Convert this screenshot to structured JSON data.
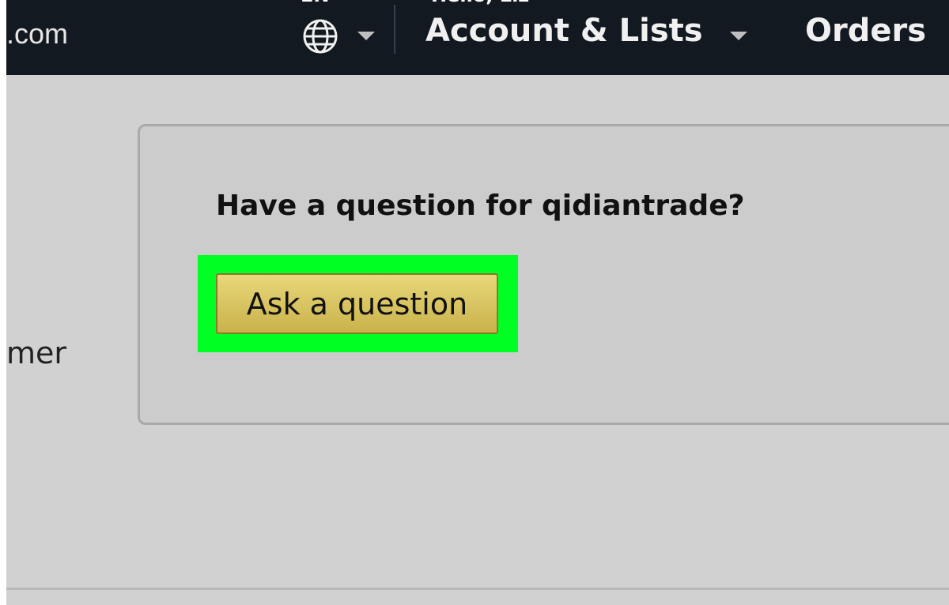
{
  "header": {
    "domain_partial": ".com",
    "lang_partial": "EN",
    "greeting_partial": "Hello, Liz",
    "account_label": "Account & Lists",
    "orders_label": "Orders"
  },
  "main": {
    "question_heading": "Have a question for qidiantrade?",
    "ask_button_label": "Ask a question",
    "side_text_partial": "mer"
  },
  "colors": {
    "header_bg": "#131921",
    "page_bg": "#d1d1d1",
    "highlight": "#00ff22",
    "button_top": "#e9d77a",
    "button_bottom": "#c8b24a"
  },
  "icons": {
    "language": "globe-icon",
    "dropdown": "caret-down-icon"
  }
}
